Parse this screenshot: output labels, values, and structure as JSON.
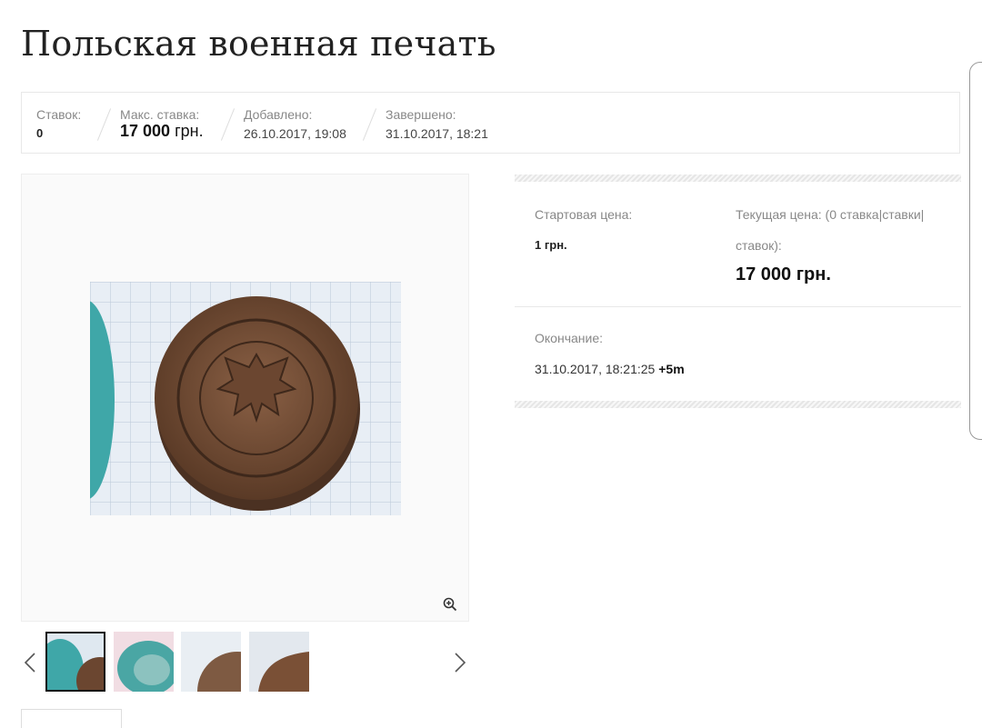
{
  "title": "Польская военная печать",
  "stats": {
    "bids_label": "Ставок:",
    "bids_value": "0",
    "max_bid_label": "Макс. ставка:",
    "max_bid_amount": "17 000",
    "max_bid_currency": "грн.",
    "added_label": "Добавлено:",
    "added_value": "26.10.2017, 19:08",
    "ended_label": "Завершено:",
    "ended_value": "31.10.2017, 18:21"
  },
  "prices": {
    "start_label": "Стартовая цена:",
    "start_value": "1 грн.",
    "current_label_line1": "Текущая цена: (0 ставка|ставки|",
    "current_label_line2": "ставок):",
    "current_value": "17 000 грн."
  },
  "ending": {
    "label": "Окончание:",
    "datetime": "31.10.2017, 18:21:25",
    "extension": "+5m"
  },
  "gallery": {
    "thumbnails": [
      "thumb-1",
      "thumb-2",
      "thumb-3",
      "thumb-4"
    ],
    "active_index": 0
  },
  "icons": {
    "zoom": "zoom-in-icon",
    "prev": "chevron-left-icon",
    "next": "chevron-right-icon"
  },
  "colors": {
    "text": "#333333",
    "muted": "#888888",
    "border": "#e8e8e8"
  }
}
